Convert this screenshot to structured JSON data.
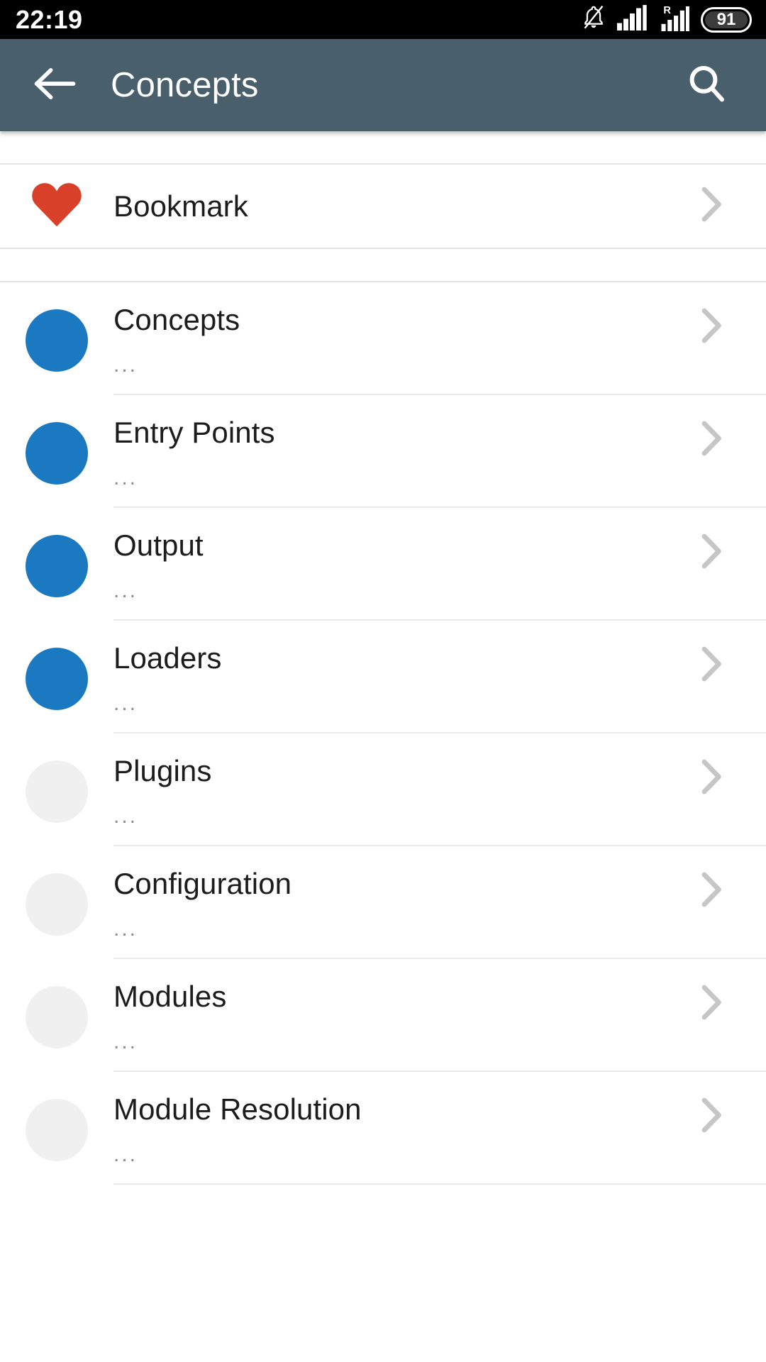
{
  "status_bar": {
    "time": "22:19",
    "battery_percent": "91",
    "icons": [
      "bell-muted-icon",
      "signal-bars-icon",
      "roaming-signal-icon",
      "battery-icon"
    ]
  },
  "app_bar": {
    "title": "Concepts",
    "back_icon": "arrow-left-icon",
    "search_icon": "search-icon",
    "background_color": "#4a5f6c"
  },
  "bookmark": {
    "label": "Bookmark",
    "icon": "heart-icon",
    "icon_color": "#d9402a",
    "chevron_icon": "chevron-right-icon"
  },
  "colors": {
    "avatar_loaded": "#1b79c2",
    "avatar_placeholder": "#f0f0f0",
    "chevron": "#c6c6c6",
    "title_text": "#1c1c1c",
    "subtitle_text": "#8d8d8d"
  },
  "list": {
    "subtitle_placeholder": "...",
    "items": [
      {
        "title": "Concepts",
        "subtitle": "...",
        "avatar_state": "blue"
      },
      {
        "title": "Entry Points",
        "subtitle": "...",
        "avatar_state": "blue"
      },
      {
        "title": "Output",
        "subtitle": "...",
        "avatar_state": "blue"
      },
      {
        "title": "Loaders",
        "subtitle": "...",
        "avatar_state": "blue"
      },
      {
        "title": "Plugins",
        "subtitle": "...",
        "avatar_state": "placeholder"
      },
      {
        "title": "Configuration",
        "subtitle": "...",
        "avatar_state": "placeholder"
      },
      {
        "title": "Modules",
        "subtitle": "...",
        "avatar_state": "placeholder"
      },
      {
        "title": "Module Resolution",
        "subtitle": "...",
        "avatar_state": "placeholder"
      }
    ]
  }
}
